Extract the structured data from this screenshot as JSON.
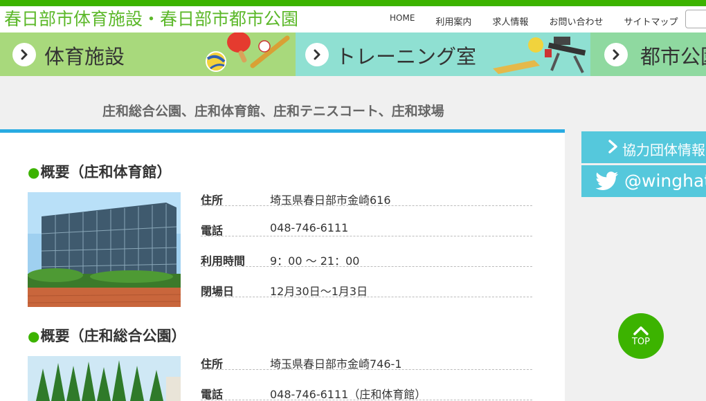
{
  "header": {
    "site_title": "春日部市体育施設・春日部市都市公園",
    "nav": [
      "HOME",
      "利用案内",
      "求人情報",
      "お問い合わせ",
      "サイトマップ"
    ],
    "search_placeholder": ""
  },
  "banners": [
    {
      "label": "体育施設",
      "color": "#a8d97c"
    },
    {
      "label": "トレーニング室",
      "color": "#8fe0d2"
    },
    {
      "label": "都市公園",
      "color": "#8fd9a0"
    }
  ],
  "page": {
    "heading": "庄和総合公園、庄和体育館、庄和テニスコート、庄和球場"
  },
  "sections": [
    {
      "title": "概要（庄和体育館）",
      "rows": [
        {
          "key": "住所",
          "value": "埼玉県春日部市金崎616"
        },
        {
          "key": "電話",
          "value": "048-746-6111"
        },
        {
          "key": "利用時間",
          "value": "9：00 〜 21：00"
        },
        {
          "key": "閉場日",
          "value": "12月30日〜1月3日"
        }
      ]
    },
    {
      "title": "概要（庄和総合公園）",
      "rows": [
        {
          "key": "住所",
          "value": "埼玉県春日部市金崎746-1"
        },
        {
          "key": "電話",
          "value": "048-746-6111（庄和体育館）"
        }
      ]
    }
  ],
  "sidebar": {
    "partner_label": "協力団体情報",
    "twitter_label": "@winghat"
  },
  "back_to_top": "TOP",
  "colors": {
    "accent_green": "#3cb300",
    "rule_blue": "#29abe2",
    "side_button": "#55c8dc"
  }
}
